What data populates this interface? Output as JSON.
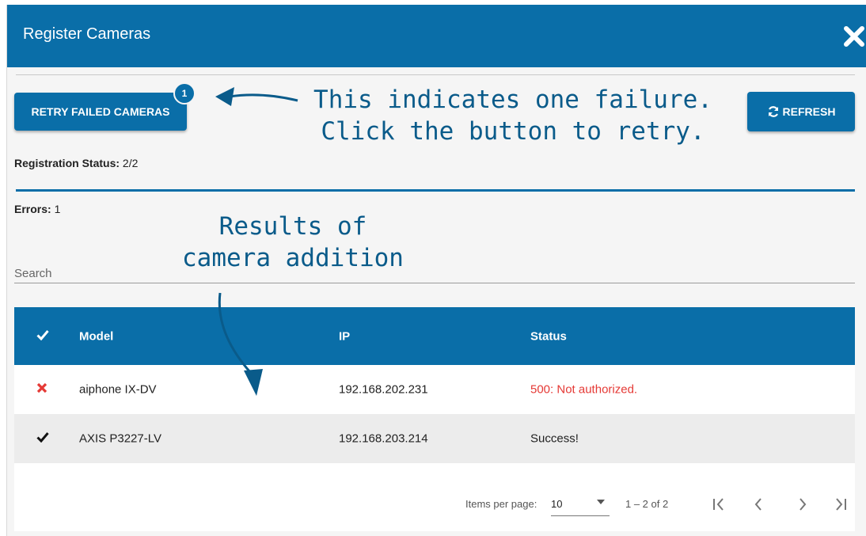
{
  "dialog": {
    "title": "Register Cameras"
  },
  "toolbar": {
    "retry_label": "RETRY FAILED CAMERAS",
    "retry_badge": "1",
    "refresh_label": "REFRESH"
  },
  "status": {
    "registration_label": "Registration Status:",
    "registration_value": "2/2",
    "errors_label": "Errors:",
    "errors_value": "1"
  },
  "search": {
    "placeholder": "Search"
  },
  "annotations": {
    "top_line1": "This indicates one failure.",
    "top_line2": "Click the button to retry.",
    "mid_line1": "Results of",
    "mid_line2": "camera addition"
  },
  "table": {
    "headers": [
      "Model",
      "IP",
      "Status"
    ],
    "rows": [
      {
        "status_icon": "x-icon",
        "model": "aiphone IX-DV",
        "ip": "192.168.202.231",
        "status": "500: Not authorized.",
        "error": true
      },
      {
        "status_icon": "check-icon",
        "model": "AXIS P3227-LV",
        "ip": "192.168.203.214",
        "status": "Success!",
        "error": false
      }
    ]
  },
  "pagination": {
    "items_per_page_label": "Items per page:",
    "items_per_page_value": "10",
    "range_label": "1 – 2 of 2"
  },
  "colors": {
    "primary": "#0a6ea8",
    "error": "#e53935",
    "annotation": "#0a5b8a"
  }
}
